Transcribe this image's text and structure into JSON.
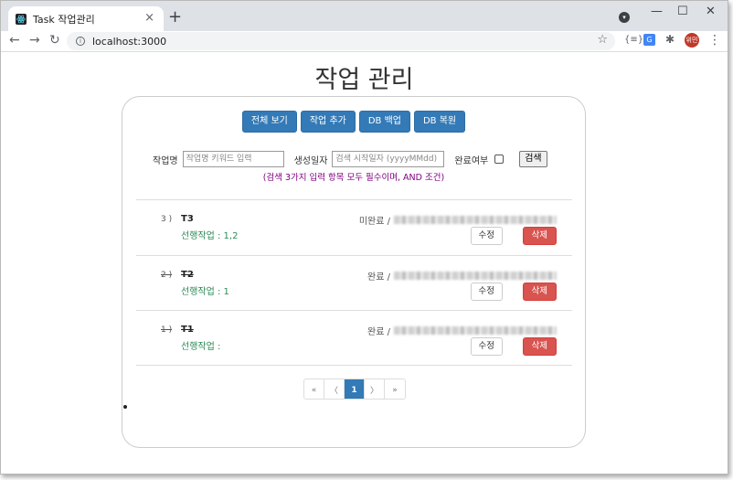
{
  "browser": {
    "tab_title": "Task 작업관리",
    "tab_close": "×",
    "new_tab": "+",
    "url": "localhost:3000",
    "avatar_text": "위민",
    "window_controls": {
      "minimize": "—",
      "maximize": "☐",
      "close": "✕"
    }
  },
  "page": {
    "title": "작업 관리",
    "buttons": {
      "view_all": "전체 보기",
      "add_task": "작업 추가",
      "db_backup": "DB 백업",
      "db_restore": "DB 복원"
    },
    "search": {
      "name_label": "작업명",
      "name_placeholder": "작업명 키워드 입력",
      "date_label": "생성일자",
      "date_placeholder": "검색 시작일자 (yyyyMMdd)",
      "done_label": "완료여부",
      "search_button": "검색",
      "hint": "(검색 3가지 입력 항목 모두 필수이며, AND 조건)"
    },
    "tasks": [
      {
        "num": "3 )",
        "name": "T3",
        "pre": "선행작업 : 1,2",
        "status": "미완료 /",
        "edit": "수정",
        "delete": "삭제",
        "done": false
      },
      {
        "num": "2 )",
        "name": "T2",
        "pre": "선행작업 : 1",
        "status": "완료 /",
        "edit": "수정",
        "delete": "삭제",
        "done": true
      },
      {
        "num": "1 )",
        "name": "T1",
        "pre": "선행작업 :",
        "status": "완료 /",
        "edit": "수정",
        "delete": "삭제",
        "done": true
      }
    ],
    "pagination": {
      "first": "«",
      "prev": "〈",
      "current": "1",
      "next": "〉",
      "last": "»"
    }
  },
  "colors": {
    "primary": "#337ab7",
    "danger": "#d9534f",
    "hint": "#800080",
    "prerequisite": "#2e8b57"
  }
}
